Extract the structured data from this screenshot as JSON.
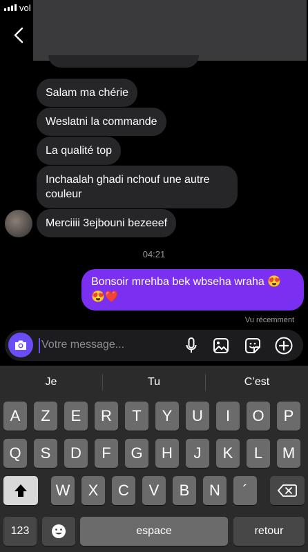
{
  "status_bar": {
    "carrier": "vol"
  },
  "header": {
    "back_icon": "chevron-left-icon"
  },
  "messages": {
    "incoming": [
      "Salam ma chérie",
      "Weslatni la commande",
      "La qualité top",
      "Inchaalah ghadi nchouf une autre couleur",
      "Merciiii 3ejbouni bezeeef"
    ],
    "timestamp": "04:21",
    "outgoing": "Bonsoir mrehba bek wbseha wraha 😍😍❤️",
    "seen_label": "Vu récemment"
  },
  "composer": {
    "placeholder": "Votre message...",
    "camera_icon": "camera-icon",
    "mic_icon": "microphone-icon",
    "gallery_icon": "image-icon",
    "sticker_icon": "sticker-icon",
    "add_icon": "plus-circle-icon"
  },
  "keyboard": {
    "suggestions": [
      "Je",
      "Tu",
      "C’est"
    ],
    "row1": [
      "A",
      "Z",
      "E",
      "R",
      "T",
      "Y",
      "U",
      "I",
      "O",
      "P"
    ],
    "row2": [
      "Q",
      "S",
      "D",
      "F",
      "G",
      "H",
      "J",
      "K",
      "L",
      "M"
    ],
    "row3": [
      "W",
      "X",
      "C",
      "V",
      "B",
      "N",
      "´"
    ],
    "numbers_label": "123",
    "space_label": "espace",
    "return_label": "retour"
  },
  "colors": {
    "accent": "#7b2ff0",
    "camera": "#6a4df5",
    "incoming_bubble": "#262628"
  }
}
